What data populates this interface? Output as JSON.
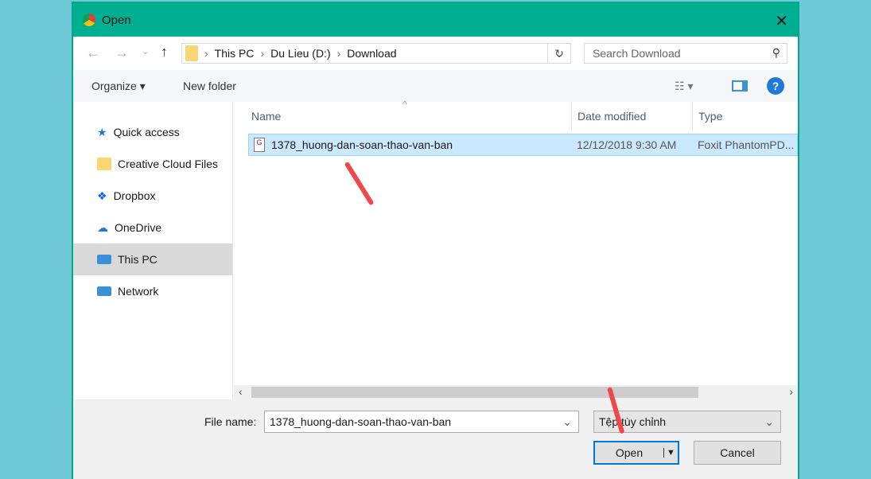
{
  "window": {
    "title": "Open",
    "close": "✕"
  },
  "address": {
    "crumbs": [
      "This PC",
      "Du Lieu (D:)",
      "Download"
    ],
    "search_placeholder": "Search Download"
  },
  "toolbar": {
    "organize": "Organize ▾",
    "new_folder": "New folder"
  },
  "sidebar": {
    "items": [
      {
        "label": "Quick access",
        "color": "#1e7ad6"
      },
      {
        "label": "Creative Cloud Files",
        "color": "#f0a030"
      },
      {
        "label": "Dropbox",
        "color": "#0061fe"
      },
      {
        "label": "OneDrive",
        "color": "#1e7ad6"
      },
      {
        "label": "This PC",
        "color": "#3d8fd8"
      },
      {
        "label": "Network",
        "color": "#3d8fd8"
      }
    ]
  },
  "columns": {
    "name": "Name",
    "date": "Date modified",
    "type": "Type"
  },
  "files": [
    {
      "name": "1378_huong-dan-soan-thao-van-ban",
      "date": "12/12/2018 9:30 AM",
      "type": "Foxit PhantomPD..."
    }
  ],
  "bottom": {
    "file_name_label": "File name:",
    "file_name": "1378_huong-dan-soan-thao-van-ban",
    "filter": "Tệp tùy chỉnh",
    "open": "Open",
    "cancel": "Cancel"
  }
}
